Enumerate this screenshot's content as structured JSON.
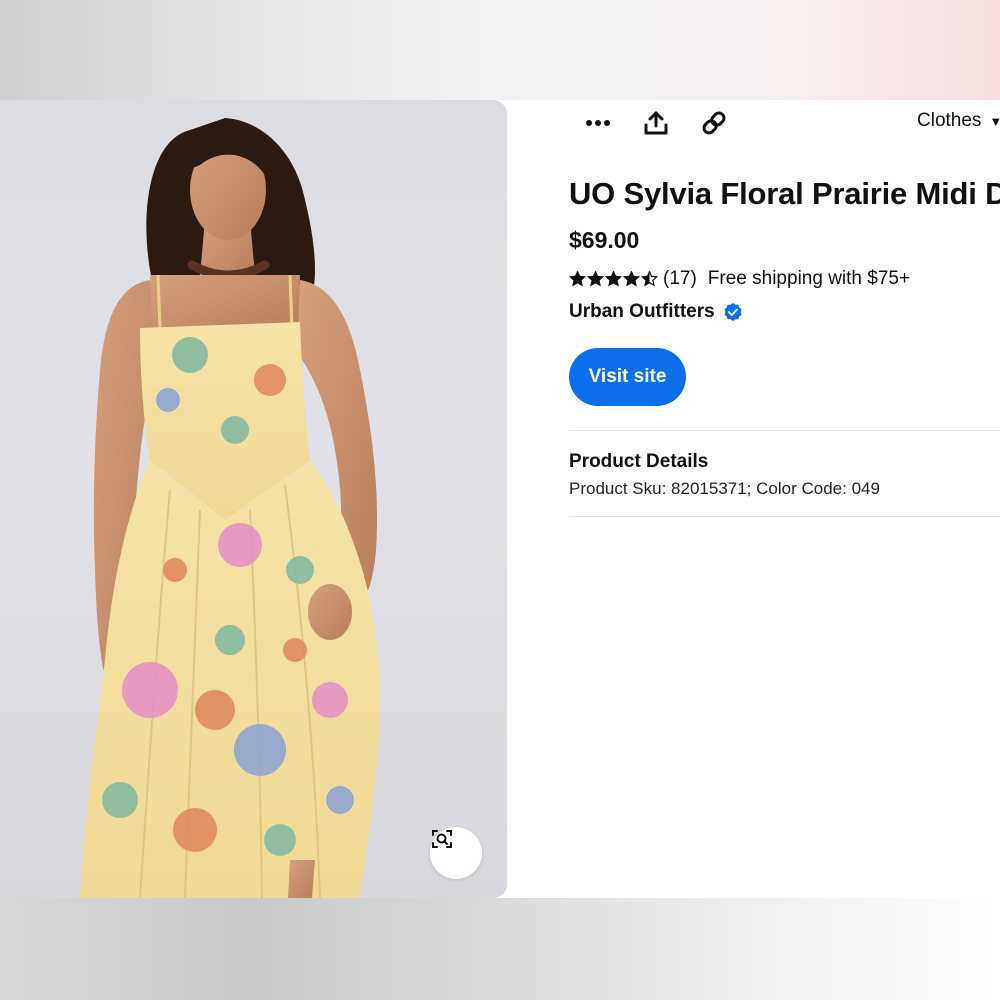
{
  "toolbar": {
    "more_icon": "more-horizontal-icon",
    "share_icon": "share-upload-icon",
    "link_icon": "link-icon",
    "board_select_label": "Clothes",
    "board_select_chevron": "chevron-down-icon"
  },
  "image": {
    "alt": "Woman wearing a yellow floral prairie midi dress",
    "visual_search_icon": "visual-search-icon"
  },
  "product": {
    "title": "UO Sylvia Floral Prairie Midi Dress",
    "price": "$69.00",
    "rating": 4.5,
    "rating_max": 5,
    "review_count": "(17)",
    "shipping": "Free shipping with $75+",
    "merchant": "Urban Outfitters",
    "merchant_verified_icon": "verified-check-icon"
  },
  "actions": {
    "visit_site_label": "Visit site"
  },
  "details_section": {
    "heading": "Product Details",
    "body": "Product Sku: 82015371; Color Code: 049"
  },
  "colors": {
    "accent": "#0a6fe8",
    "text": "#111111",
    "dress": "#f2dfa0"
  }
}
